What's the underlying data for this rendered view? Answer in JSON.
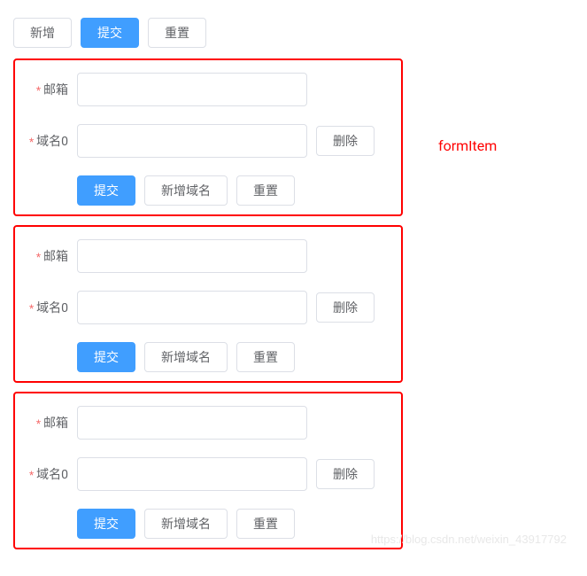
{
  "topButtons": {
    "add": "新增",
    "submit": "提交",
    "reset": "重置"
  },
  "annotation": "formItem",
  "formBoxes": [
    {
      "emailLabel": "邮箱",
      "domainLabel": "域名0",
      "deleteLabel": "删除",
      "submitLabel": "提交",
      "addDomainLabel": "新增域名",
      "resetLabel": "重置"
    },
    {
      "emailLabel": "邮箱",
      "domainLabel": "域名0",
      "deleteLabel": "删除",
      "submitLabel": "提交",
      "addDomainLabel": "新增域名",
      "resetLabel": "重置"
    },
    {
      "emailLabel": "邮箱",
      "domainLabel": "域名0",
      "deleteLabel": "删除",
      "submitLabel": "提交",
      "addDomainLabel": "新增域名",
      "resetLabel": "重置"
    }
  ],
  "watermark": "https://blog.csdn.net/weixin_43917792"
}
